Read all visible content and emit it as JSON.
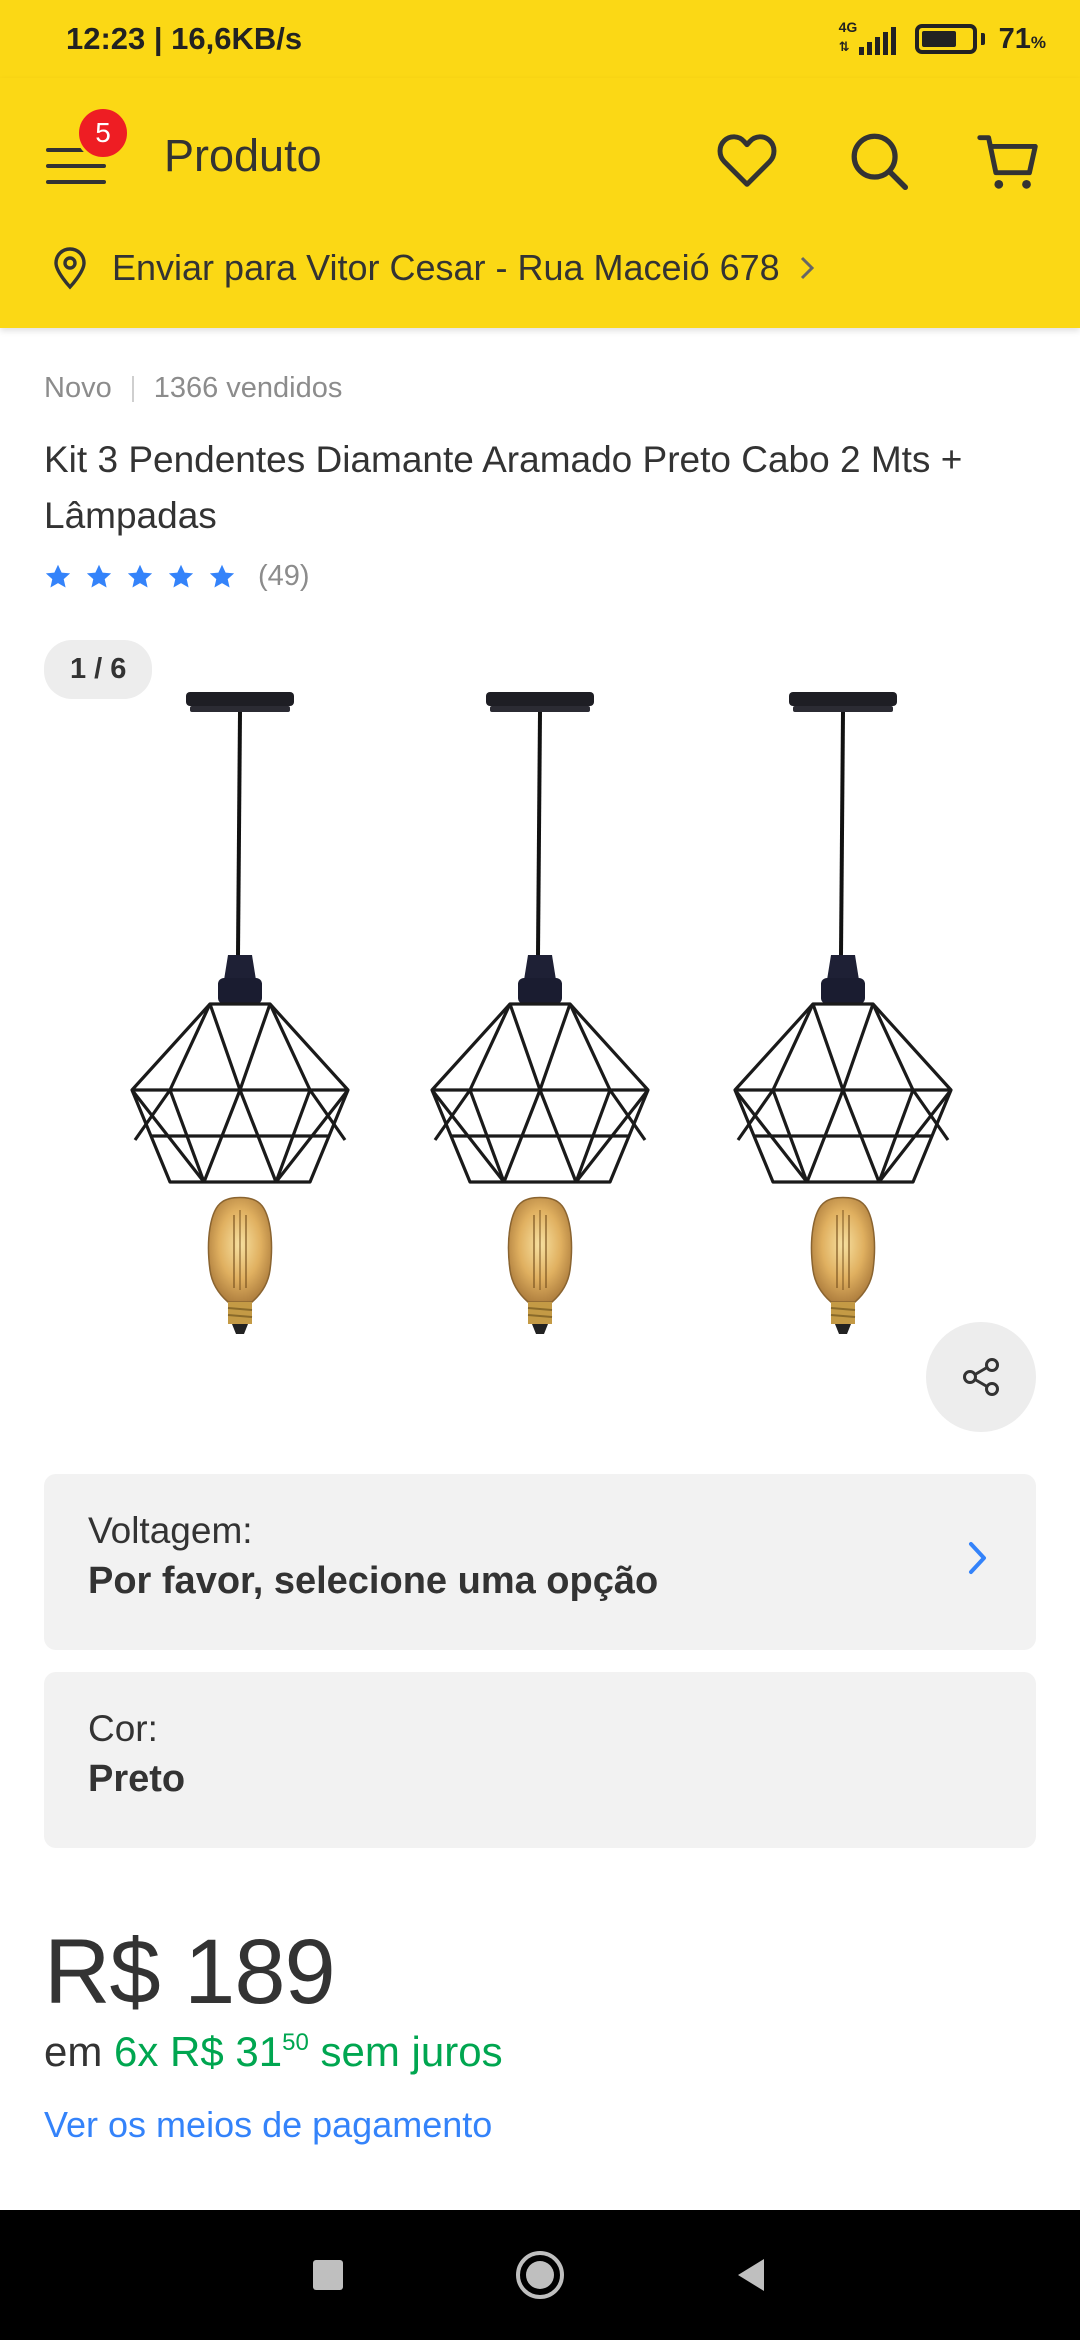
{
  "status_bar": {
    "time": "12:23 | 16,6KB/s",
    "network": "4G",
    "battery": "71",
    "battery_unit": "%"
  },
  "header": {
    "menu_badge": "5",
    "title": "Produto",
    "icons": [
      "menu-icon",
      "heart-icon",
      "search-icon",
      "cart-icon"
    ],
    "location_text": "Enviar para Vitor Cesar - Rua Maceió 678"
  },
  "product": {
    "condition": "Novo",
    "sold": "1366 vendidos",
    "title": "Kit 3 Pendentes Diamante Aramado Preto Cabo 2 Mts + Lâmpadas",
    "rating_stars": 5,
    "rating_count": "(49)",
    "gallery_counter": "1 / 6"
  },
  "variations": [
    {
      "label": "Voltagem:",
      "value": "Por favor, selecione uma opção",
      "has_chevron": true
    },
    {
      "label": "Cor:",
      "value": "Preto",
      "has_chevron": false
    }
  ],
  "price": {
    "main": "R$ 189",
    "installments_prefix": "em",
    "installments_main": "6x R$ 31",
    "installments_cents": "50",
    "installments_suffix": "sem juros",
    "payment_link": "Ver os meios de pagamento"
  },
  "colors": {
    "brand_yellow": "#fbd815",
    "badge_red": "#ee1d23",
    "link_blue": "#3483fa",
    "star_blue": "#3483fa",
    "price_green": "#00a650"
  }
}
